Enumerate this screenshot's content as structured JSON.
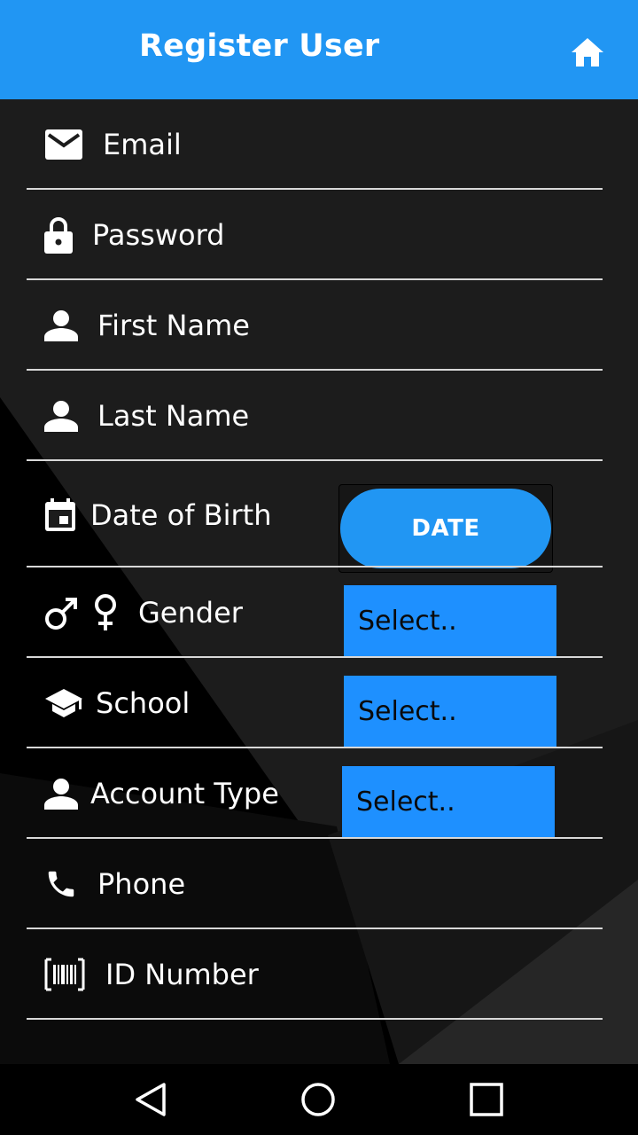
{
  "appbar": {
    "title": "Register User",
    "home_icon": "home-icon",
    "color": "#2196f3"
  },
  "form": {
    "email": {
      "label": "Email",
      "icon": "email-icon"
    },
    "password": {
      "label": "Password",
      "icon": "lock-icon"
    },
    "first_name": {
      "label": "First Name",
      "icon": "person-icon"
    },
    "last_name": {
      "label": "Last Name",
      "icon": "person-icon"
    },
    "dob": {
      "label": "Date of Birth",
      "icon": "calendar-icon",
      "button_label": "DATE"
    },
    "gender": {
      "label": "Gender",
      "icon": "gender-icon",
      "selected": "Select.."
    },
    "school": {
      "label": "School",
      "icon": "school-icon",
      "selected": "Select.."
    },
    "account_type": {
      "label": "Account Type",
      "icon": "person-icon",
      "selected": "Select.."
    },
    "phone": {
      "label": "Phone",
      "icon": "phone-icon"
    },
    "id_number": {
      "label": "ID Number",
      "icon": "barcode-icon"
    }
  },
  "navbar": {
    "back_icon": "back-icon",
    "home_icon": "home-circle-icon",
    "recents_icon": "recents-icon"
  }
}
